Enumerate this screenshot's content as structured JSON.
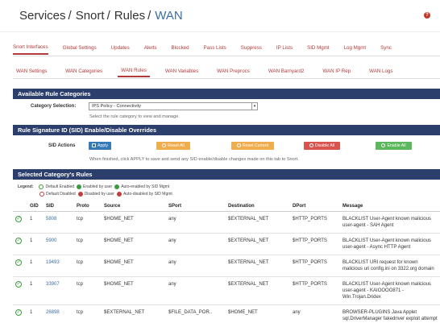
{
  "breadcrumb": [
    "Services",
    "Snort",
    "Rules",
    "WAN"
  ],
  "tabs_primary": [
    "Snort Interfaces",
    "Global Settings",
    "Updates",
    "Alerts",
    "Blocked",
    "Pass Lists",
    "Suppress",
    "IP Lists",
    "SID Mgmt",
    "Log Mgmt",
    "Sync"
  ],
  "tabs_secondary": [
    "WAN Settings",
    "WAN Categories",
    "WAN Rules",
    "WAN Variables",
    "WAN Preprocs",
    "WAN Barnyard2",
    "WAN IP Rep",
    "WAN Logs"
  ],
  "active_secondary": "WAN Rules",
  "available": {
    "header": "Available Rule Categories",
    "label": "Category Selection:",
    "selected": "IPS Policy - Connectivity",
    "hint": "Select the rule category to view and manage."
  },
  "sid_section": {
    "header": "Rule Signature ID (SID) Enable/Disable Overrides",
    "label": "SID Actions",
    "hint": "When finished, click APPLY to save and send any SID enable/disable changes made on this tab to Snort.",
    "buttons": {
      "apply": "Apply",
      "reset_all": "Reset All",
      "reset_current": "Reset Current",
      "disable_all": "Disable All",
      "enable_all": "Enable All"
    }
  },
  "selected_section": {
    "header": "Selected Category's Rules",
    "legend_title": "Legend:",
    "legend": [
      "Default Enabled",
      "Enabled by user",
      "Auto-enabled by SID Mgmt",
      "Default Disabled",
      "Disabled by user",
      "Auto-disabled by SID Mgmt"
    ]
  },
  "table": {
    "columns": [
      "",
      "GID",
      "SID",
      "Proto",
      "Source",
      "SPort",
      "Destination",
      "DPort",
      "Message"
    ],
    "rows": [
      {
        "gid": "1",
        "sid": "5808",
        "proto": "tcp",
        "src": "$HOME_NET",
        "sport": "any",
        "dst": "$EXTERNAL_NET",
        "dport": "$HTTP_PORTS",
        "msg": "BLACKLIST User-Agent known malicious user-agent - SAH Agent"
      },
      {
        "gid": "1",
        "sid": "5900",
        "proto": "tcp",
        "src": "$HOME_NET",
        "sport": "any",
        "dst": "$EXTERNAL_NET",
        "dport": "$HTTP_PORTS",
        "msg": "BLACKLIST User-Agent known malicious user-agent - Async HTTP Agent"
      },
      {
        "gid": "1",
        "sid": "19493",
        "proto": "tcp",
        "src": "$HOME_NET",
        "sport": "any",
        "dst": "$EXTERNAL_NET",
        "dport": "$HTTP_PORTS",
        "msg": "BLACKLIST URI request for known malicious uri config.ini on 3322.org domain"
      },
      {
        "gid": "1",
        "sid": "33907",
        "proto": "tcp",
        "src": "$HOME_NET",
        "sport": "any",
        "dst": "$EXTERNAL_NET",
        "dport": "$HTTP_PORTS",
        "msg": "BLACKLIST User-Agent known malicious user-agent - KAIOOOO871 - Win.Trojan.Dridex"
      },
      {
        "gid": "1",
        "sid": "26898",
        "proto": "tcp",
        "src": "$EXTERNAL_NET",
        "sport": "$FILE_DATA_POR..",
        "dst": "$HOME_NET",
        "dport": "any",
        "msg": "BROWSER-PLUGINS Java Applet sql.DriverManager fakedriver exploit attempt"
      }
    ]
  },
  "colors": {
    "header_bg": "#2c3e6b",
    "tab": "#b33a3a",
    "link": "#3a6ea5",
    "apply": "#337ab7",
    "warn": "#f0ad4e",
    "danger": "#d9534f",
    "success": "#5cb85c"
  }
}
